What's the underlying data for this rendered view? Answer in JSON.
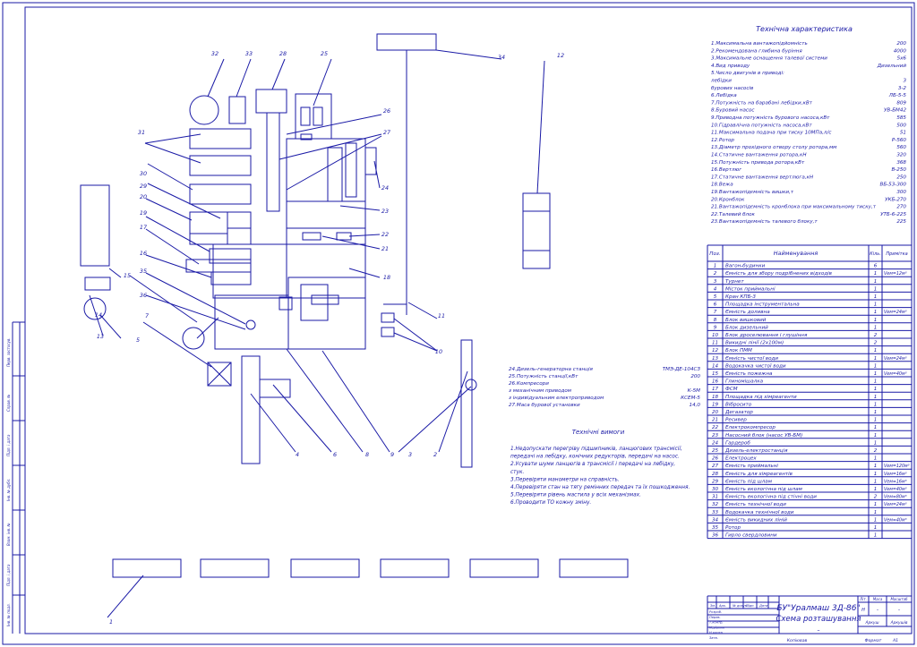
{
  "tech_title": "Технічна характеристика",
  "tech": [
    {
      "k": "1.Максимальна вантажопідйомність",
      "v": "200"
    },
    {
      "k": "2.Рекомендована глибина буріння",
      "v": "4000"
    },
    {
      "k": "3.Максимальне оснащення талевої системи",
      "v": "5х6"
    },
    {
      "k": "4.Вид приводу",
      "v": "Дизельний"
    },
    {
      "k": "5.Число двигунів в приводі:",
      "v": ""
    },
    {
      "k": "  лебідки",
      "v": "3"
    },
    {
      "k": "  бурових насосів",
      "v": "3-2"
    },
    {
      "k": "6.Лебідка",
      "v": "ЛБ-5-5"
    },
    {
      "k": "7.Потужність на барабані лебідки,кВт",
      "v": "809"
    },
    {
      "k": "8.Буровий насос",
      "v": "УВ-БМ42"
    },
    {
      "k": "9.Приводна потужність бурового насоса,кВт",
      "v": "585"
    },
    {
      "k": "10.Гідравлічна потужність насоса,кВт",
      "v": "500"
    },
    {
      "k": "11.Максимальна подача при тиску 10МПа,л/с",
      "v": "51"
    },
    {
      "k": "12.Ротор",
      "v": "Р-560"
    },
    {
      "k": "13.Діаметр прохідного отвору столу ротора,мм",
      "v": "560"
    },
    {
      "k": "14.Статичне вантаження ротора,кН",
      "v": "320"
    },
    {
      "k": "15.Потужність привода ротора,кВт",
      "v": "368"
    },
    {
      "k": "16.Вертлюг",
      "v": "В-250"
    },
    {
      "k": "17.Статичне вантаження вертлюга,кН",
      "v": "250"
    },
    {
      "k": "18.Вежа",
      "v": "ВБ-53-300"
    },
    {
      "k": "19.Вантажопідємність вишки,т",
      "v": "300"
    },
    {
      "k": "20.Кронблок",
      "v": "УКБ-270"
    },
    {
      "k": "21.Вантажопідємність кронблока при максимальному тиску,т",
      "v": "270"
    },
    {
      "k": "22.Талевий блок",
      "v": "УТБ-6-225"
    },
    {
      "k": "23.Вантажопідємність талевого блоку,т",
      "v": "225"
    }
  ],
  "tech2": [
    {
      "k": "24.Дизель-генераторна станція",
      "v": "ТМЭ-ДЕ-104СЗ"
    },
    {
      "k": "25.Потужність станції,кВт",
      "v": "200"
    },
    {
      "k": "26.Компресори",
      "v": ""
    },
    {
      "k": "  з механічним приводом",
      "v": "К-5М"
    },
    {
      "k": "  з індивідуальним електроприводом",
      "v": "КСЕМ-5"
    },
    {
      "k": "27.Маса бурової установки",
      "v": "14,0"
    }
  ],
  "req_title": "Технічні вимоги",
  "req": [
    "1.Недопускати перегріву підшипників, ланцюгових трансмісії,",
    "передачі на лебідку, конічних редукторів, передачі на насос.",
    "2.Усувати шуми ланцюгів в трансмісії і передачі на лебідку,",
    "стук.",
    "3.Перевіряти манометри на справність.",
    "4.Перевіряти стан на тягу ремінних передач та їх пошкодження.",
    "5.Перевіряти рівень мастила у всіх механізмах.",
    "6.Проводити ТО кожну зміну."
  ],
  "table_headers": {
    "pos": "Поз.",
    "name": "Найменування",
    "qty": "Кіль.",
    "note": "Примітка"
  },
  "items": [
    {
      "p": "1",
      "n": "Вагон-будинки",
      "q": "6",
      "r": ""
    },
    {
      "p": "2",
      "n": "Ємність для збору подрібнених відходів",
      "q": "1",
      "r": "Vем=12м³"
    },
    {
      "p": "3",
      "n": "Турнет",
      "q": "1",
      "r": ""
    },
    {
      "p": "4",
      "n": "Місток приймальні",
      "q": "1",
      "r": ""
    },
    {
      "p": "5",
      "n": "Кран КПБ-3",
      "q": "1",
      "r": ""
    },
    {
      "p": "6",
      "n": "Площадка інструментальна",
      "q": "1",
      "r": ""
    },
    {
      "p": "7",
      "n": "Ємність доливна",
      "q": "1",
      "r": "Vем=24м³"
    },
    {
      "p": "8",
      "n": "Блок вишковий",
      "q": "1",
      "r": ""
    },
    {
      "p": "9",
      "n": "Блок дизельний",
      "q": "1",
      "r": ""
    },
    {
      "p": "10",
      "n": "Блок дроселювання і глушіння",
      "q": "2",
      "r": ""
    },
    {
      "p": "11",
      "n": "Викидні лінії (2х100м)",
      "q": "2",
      "r": ""
    },
    {
      "p": "12",
      "n": "Блок ПММ",
      "q": "1",
      "r": ""
    },
    {
      "p": "13",
      "n": "Ємність чистої води",
      "q": "1",
      "r": "Vем=24м³"
    },
    {
      "p": "14",
      "n": "Водокачка чистої води",
      "q": "1",
      "r": ""
    },
    {
      "p": "15",
      "n": "Ємність пожежна",
      "q": "1",
      "r": "Vем=40м³"
    },
    {
      "p": "16",
      "n": "Глиномішалка",
      "q": "1",
      "r": ""
    },
    {
      "p": "17",
      "n": "ФСМ",
      "q": "1",
      "r": ""
    },
    {
      "p": "18",
      "n": "Площадка під хімреагенти",
      "q": "1",
      "r": ""
    },
    {
      "p": "19",
      "n": "Вібросито",
      "q": "1",
      "r": ""
    },
    {
      "p": "20",
      "n": "Дегазатор",
      "q": "1",
      "r": ""
    },
    {
      "p": "21",
      "n": "Ресивер",
      "q": "1",
      "r": ""
    },
    {
      "p": "22",
      "n": "Електрокомпресор",
      "q": "1",
      "r": ""
    },
    {
      "p": "23",
      "n": "Насосний блок (насос УВ-БМ)",
      "q": "1",
      "r": ""
    },
    {
      "p": "24",
      "n": "Гардероб",
      "q": "1",
      "r": ""
    },
    {
      "p": "25",
      "n": "Дизель-електростанція",
      "q": "2",
      "r": ""
    },
    {
      "p": "26",
      "n": "Електроцех",
      "q": "1",
      "r": ""
    },
    {
      "p": "27",
      "n": "Ємність приймальні",
      "q": "1",
      "r": "Vем=120м³"
    },
    {
      "p": "28",
      "n": "Ємність для хімреагентів",
      "q": "1",
      "r": "Vем=16м³"
    },
    {
      "p": "29",
      "n": "Ємність під шлам",
      "q": "1",
      "r": "Vем=16м³"
    },
    {
      "p": "30",
      "n": "Ємність екологічна під шлам",
      "q": "1",
      "r": "Vем=40м³"
    },
    {
      "p": "31",
      "n": "Ємність екологічна під стічні води",
      "q": "2",
      "r": "Vем=80м³"
    },
    {
      "p": "32",
      "n": "Ємність технічної води",
      "q": "1",
      "r": "Vем=24м³"
    },
    {
      "p": "33",
      "n": "Водокачка технічної води",
      "q": "1",
      "r": ""
    },
    {
      "p": "34",
      "n": "Ємність викидних ліній",
      "q": "1",
      "r": "Vем=40м³"
    },
    {
      "p": "35",
      "n": "Ротор",
      "q": "1",
      "r": ""
    },
    {
      "p": "36",
      "n": "Гирло свердловини",
      "q": "1",
      "r": ""
    }
  ],
  "stamp": {
    "title1": "БУ\"Уралмаш 3Д-86\"",
    "title2": "Схема розташування",
    "lit": "Літ.",
    "massa": "Маса",
    "masht": "Масштаб",
    "lit_val": "Н",
    "dash": "–",
    "arkush": "Аркуш",
    "arkushiv": "Аркушів",
    "small_dash": "–",
    "rows": [
      "Зм.",
      "Арк.",
      "№ докум.",
      "Підп.",
      "Дата"
    ],
    "left_roles": [
      "Розроб.",
      "Перев.",
      "Т.контр.",
      "Керівник",
      "Н.контр.",
      "Затв."
    ]
  },
  "footer": {
    "kopiyuvav": "Копіював",
    "format": "Формат",
    "format_val": "А1"
  },
  "side_labels": [
    "Перв. застосув.",
    "Справ. №",
    "Підп. і дата",
    "Інв. № дубл.",
    "Взам. інв. №",
    "Підп. і дата",
    "Інв. № подл."
  ],
  "callouts": [
    "1",
    "2",
    "3",
    "4",
    "5",
    "6",
    "7",
    "8",
    "9",
    "10",
    "11",
    "12",
    "13",
    "14",
    "15",
    "16",
    "17",
    "18",
    "19",
    "20",
    "21",
    "22",
    "23",
    "24",
    "25",
    "26",
    "27",
    "28",
    "29",
    "30",
    "31",
    "32",
    "33",
    "34",
    "35",
    "36"
  ]
}
